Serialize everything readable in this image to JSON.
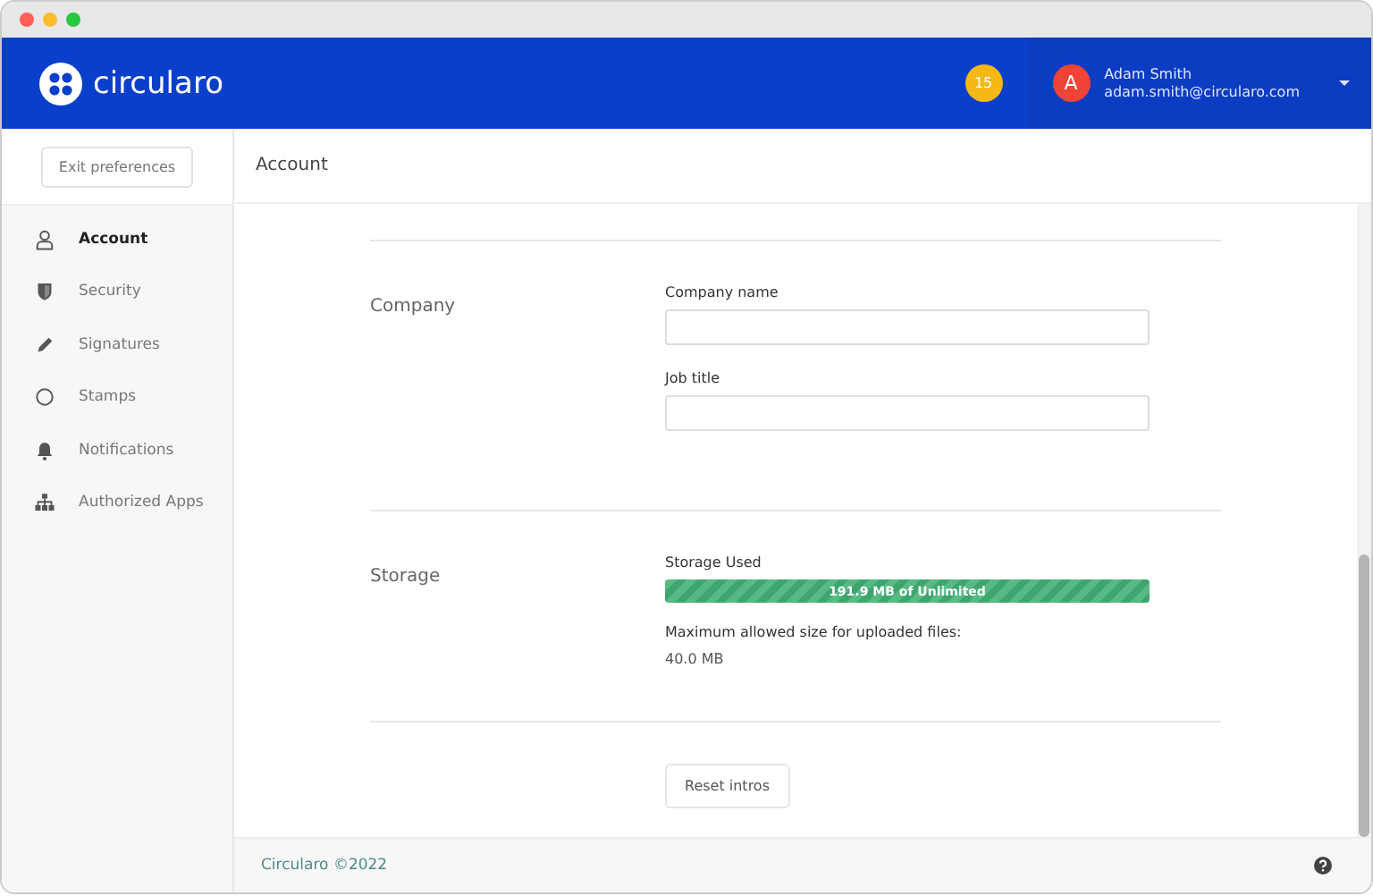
{
  "header": {
    "brand": "circularo",
    "notification_count": "15",
    "user": {
      "initial": "A",
      "name": "Adam Smith",
      "email": "adam.smith@circularo.com"
    }
  },
  "sidebar": {
    "exit_button": "Exit preferences",
    "items": [
      {
        "label": "Account",
        "selected": true
      },
      {
        "label": "Security",
        "selected": false
      },
      {
        "label": "Signatures",
        "selected": false
      },
      {
        "label": "Stamps",
        "selected": false
      },
      {
        "label": "Notifications",
        "selected": false
      },
      {
        "label": "Authorized Apps",
        "selected": false
      }
    ]
  },
  "page_title": "Account",
  "sections": [
    {
      "kind": "fields",
      "title": "Company",
      "fields": [
        {
          "label": "Company name"
        },
        {
          "label": "Job title"
        }
      ]
    },
    {
      "kind": "storage",
      "title": "Storage",
      "used_label": "Storage Used",
      "level": 1,
      "reading": "191.9 MB of Unlimited",
      "max_label": "Maximum allowed size for uploaded files:",
      "max_value": "40.0 MB"
    },
    {
      "kind": "button",
      "button": "Reset intros"
    }
  ],
  "footer": {
    "copyright": "Circularo ©2022"
  }
}
